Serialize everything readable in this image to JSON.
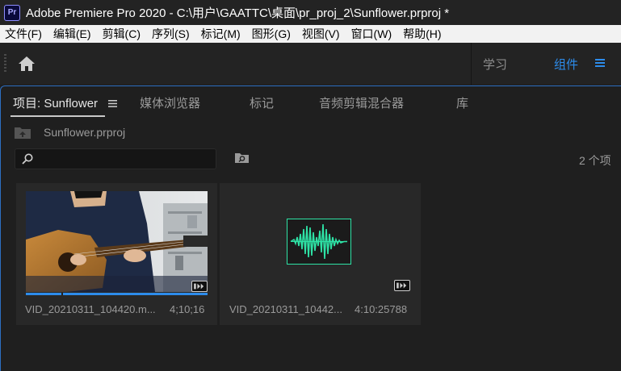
{
  "window": {
    "app_icon_text": "Pr",
    "title": "Adobe Premiere Pro 2020 - C:\\用户\\GAATTC\\桌面\\pr_proj_2\\Sunflower.prproj *"
  },
  "menu": [
    "文件(F)",
    "编辑(E)",
    "剪辑(C)",
    "序列(S)",
    "标记(M)",
    "图形(G)",
    "视图(V)",
    "窗口(W)",
    "帮助(H)"
  ],
  "workspaces": {
    "learn": "学习",
    "components": "组件",
    "active_color": "#2d8ceb"
  },
  "panel": {
    "tabs": [
      "项目: Sunflower",
      "媒体浏览器",
      "标记",
      "音频剪辑混合器",
      "库"
    ],
    "active_tab": "项目: Sunflower",
    "project_file": "Sunflower.prproj",
    "search_value": "",
    "item_count": "2 个项",
    "accent": "#2d6fc2"
  },
  "items": [
    {
      "name": "VID_20210311_104420.m...",
      "duration": "4;10;16",
      "kind": "video",
      "icon": "video-badge-icon"
    },
    {
      "name": "VID_20210311_10442...",
      "duration": "4:10:25788",
      "kind": "audio",
      "icon": "audio-badge-icon",
      "waveform_color": "#2ee3a6"
    }
  ]
}
